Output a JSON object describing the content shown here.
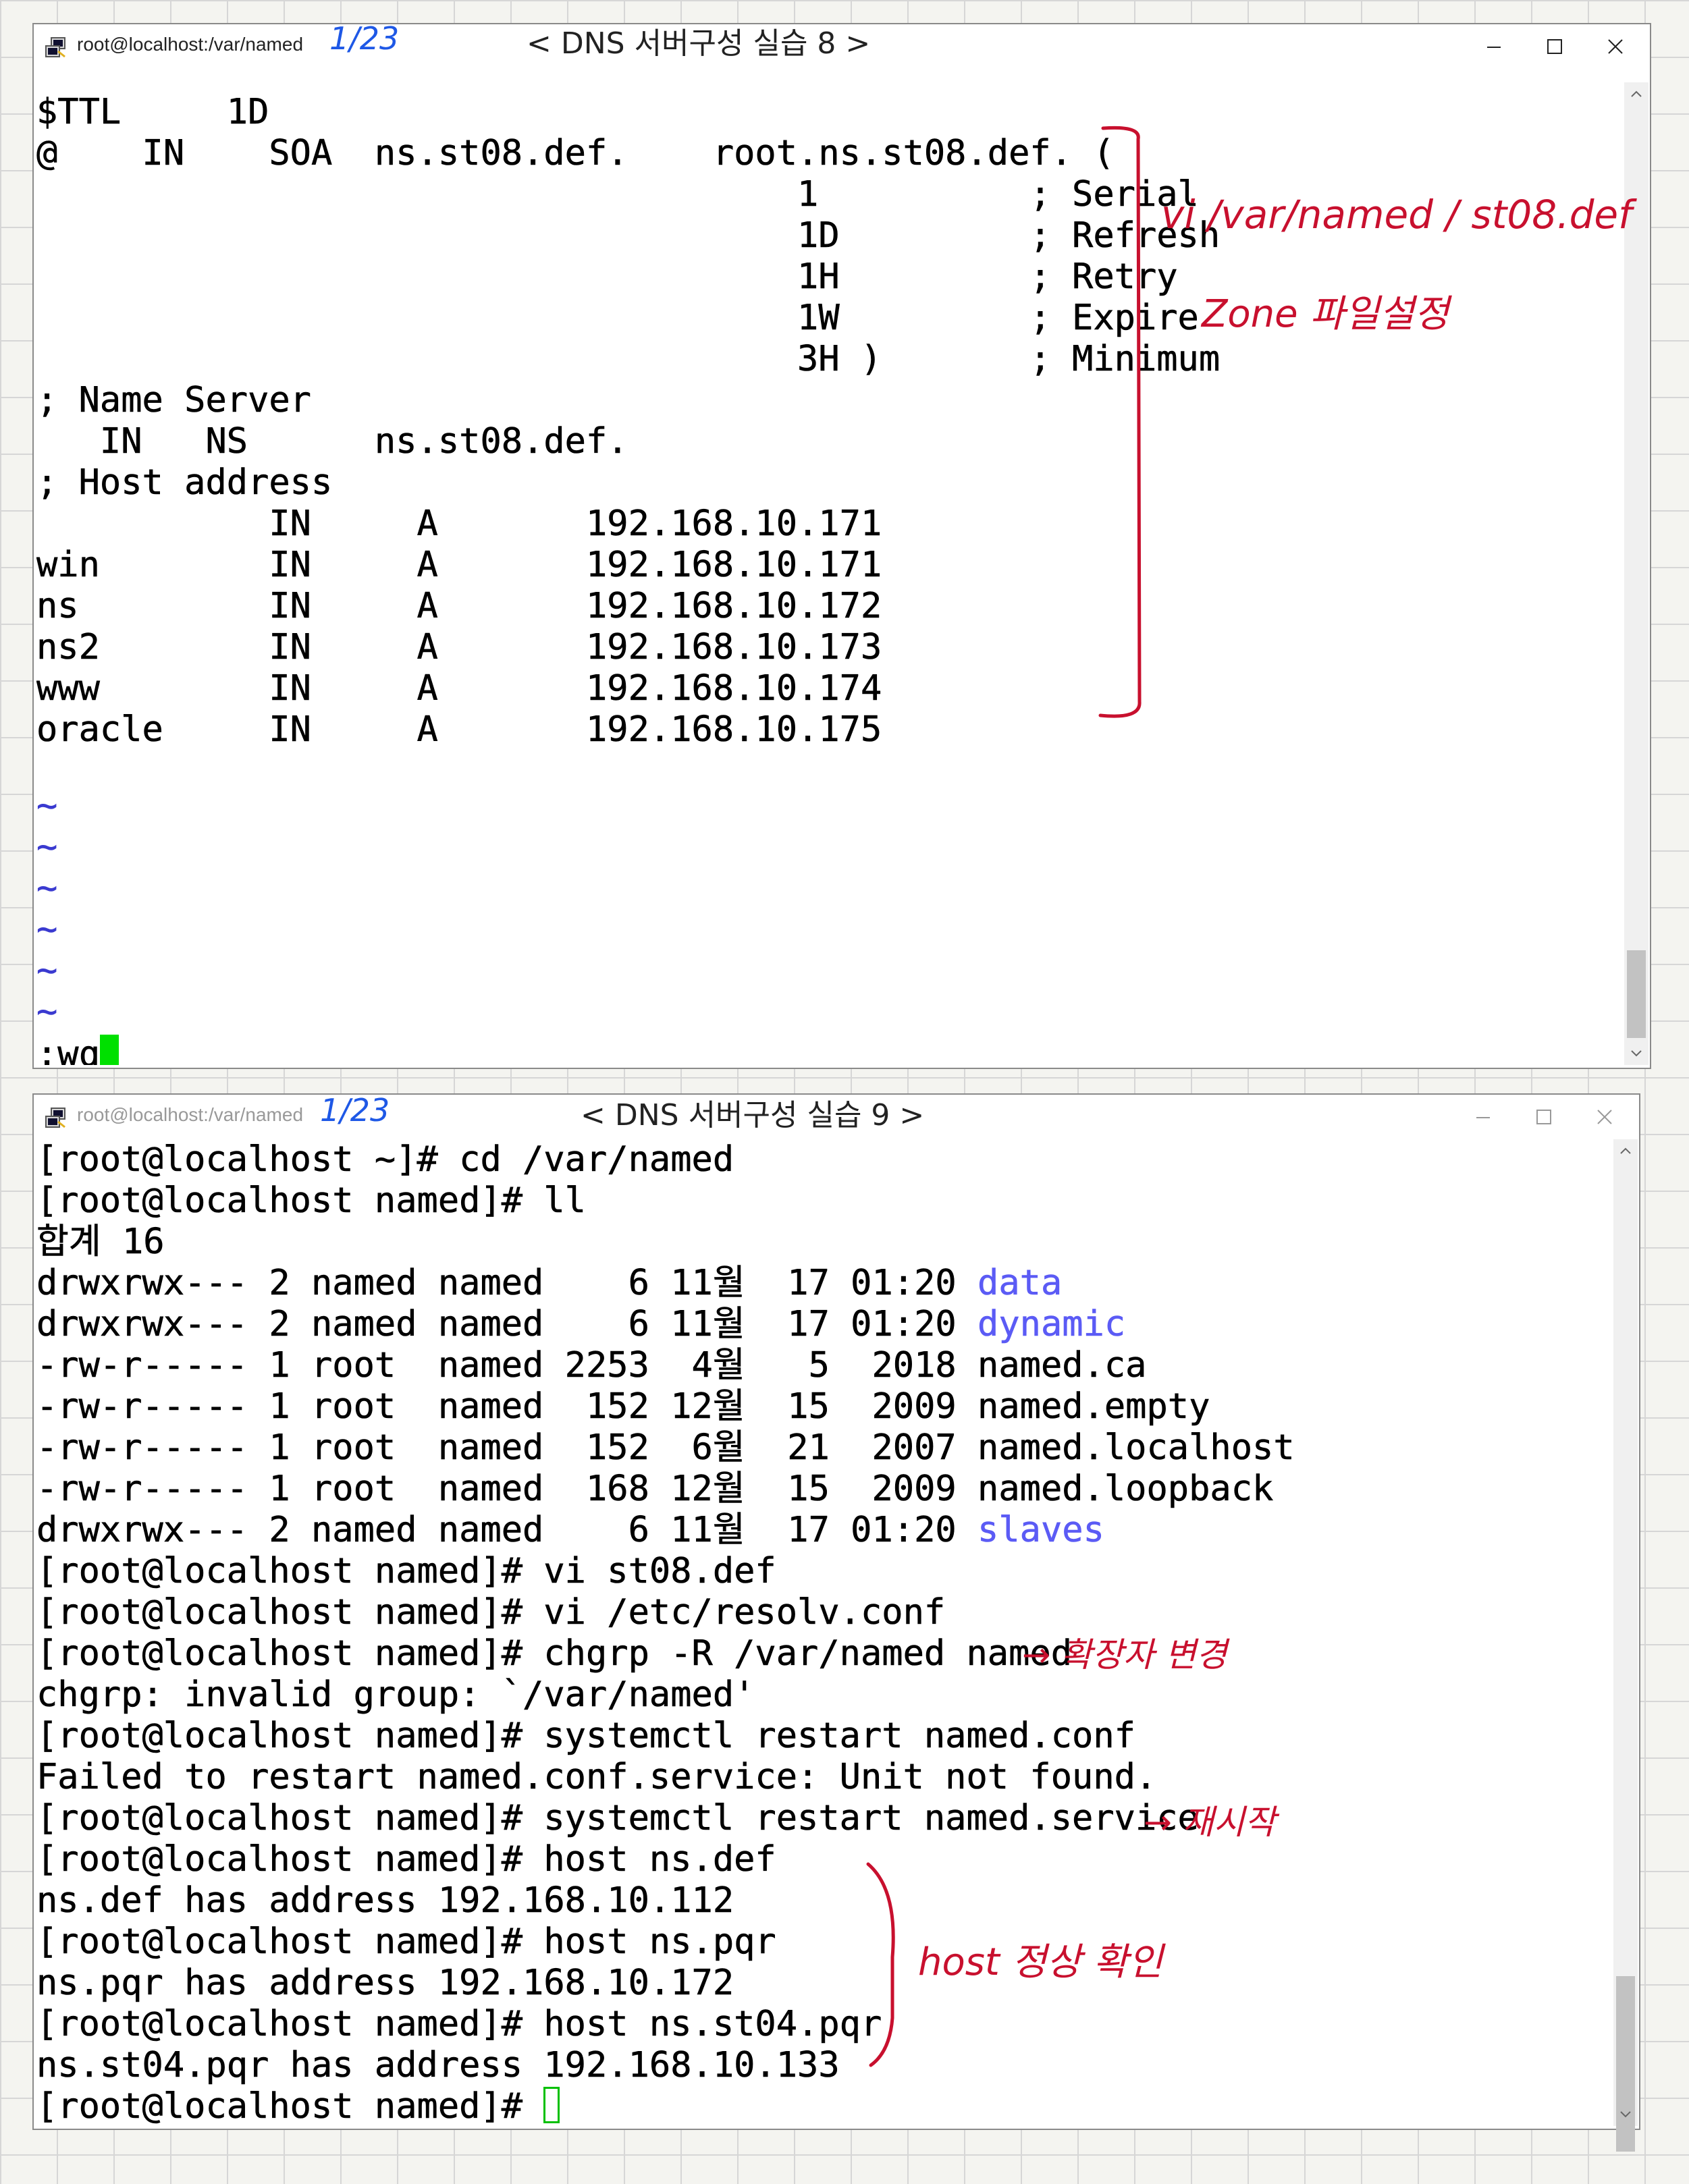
{
  "window1": {
    "title": "root@localhost:/var/named",
    "lines": [
      "$TTL     1D",
      "@    IN    SOA  ns.st08.def.    root.ns.st08.def. (",
      "                                    1          ; Serial",
      "                                    1D         ; Refresh",
      "                                    1H         ; Retry",
      "                                    1W         ; Expire",
      "                                    3H )       ; Minimum",
      "; Name Server",
      "   IN   NS      ns.st08.def.",
      "; Host address",
      "           IN     A       192.168.10.171",
      "win        IN     A       192.168.10.171",
      "ns         IN     A       192.168.10.172",
      "ns2        IN     A       192.168.10.173",
      "www        IN     A       192.168.10.174",
      "oracle     IN     A       192.168.10.175"
    ],
    "tildes": [
      "~",
      "~",
      "~",
      "~",
      "~",
      "~"
    ],
    "command_line": ":wq"
  },
  "window2": {
    "title": "root@localhost:/var/named",
    "lines": [
      {
        "text": "[root@localhost ~]# cd /var/named"
      },
      {
        "text": "[root@localhost named]# ll"
      },
      {
        "text": "합계 16"
      },
      {
        "text": "drwxrwx--- 2 named named    6 11월  17 01:20 ",
        "blue": "data"
      },
      {
        "text": "drwxrwx--- 2 named named    6 11월  17 01:20 ",
        "blue": "dynamic"
      },
      {
        "text": "-rw-r----- 1 root  named 2253  4월   5  2018 named.ca"
      },
      {
        "text": "-rw-r----- 1 root  named  152 12월  15  2009 named.empty"
      },
      {
        "text": "-rw-r----- 1 root  named  152  6월  21  2007 named.localhost"
      },
      {
        "text": "-rw-r----- 1 root  named  168 12월  15  2009 named.loopback"
      },
      {
        "text": "drwxrwx--- 2 named named    6 11월  17 01:20 ",
        "blue": "slaves"
      },
      {
        "text": "[root@localhost named]# vi st08.def"
      },
      {
        "text": "[root@localhost named]# vi /etc/resolv.conf"
      },
      {
        "text": "[root@localhost named]# chgrp -R /var/named named"
      },
      {
        "text": "chgrp: invalid group: `/var/named'"
      },
      {
        "text": "[root@localhost named]# systemctl restart named.conf"
      },
      {
        "text": "Failed to restart named.conf.service: Unit not found."
      },
      {
        "text": "[root@localhost named]# systemctl restart named.service"
      },
      {
        "text": "[root@localhost named]# host ns.def"
      },
      {
        "text": "ns.def has address 192.168.10.112"
      },
      {
        "text": "[root@localhost named]# host ns.pqr"
      },
      {
        "text": "ns.pqr has address 192.168.10.172"
      },
      {
        "text": "[root@localhost named]# host ns.st04.pqr"
      },
      {
        "text": "ns.st04.pqr has address 192.168.10.133"
      },
      {
        "text": "[root@localhost named]# "
      }
    ]
  },
  "annotations": {
    "date1": "1/23",
    "heading1": "< DNS 서버구성 실습 8 >",
    "vi_path": "vi /var/named / st08.def",
    "zone_note": "Zone 파일설정",
    "date2": "1/23",
    "heading2": "< DNS 서버구성 실습 9 >",
    "chgrp_note": "→ 확장자 변경",
    "restart_note": "→ 재시작",
    "host_note": "host 정상 확인"
  },
  "colors": {
    "directory_blue": "#5b5bf5",
    "cursor_green": "#00e000",
    "ink_red": "#c8102e",
    "ink_blue": "#1e58e6"
  }
}
